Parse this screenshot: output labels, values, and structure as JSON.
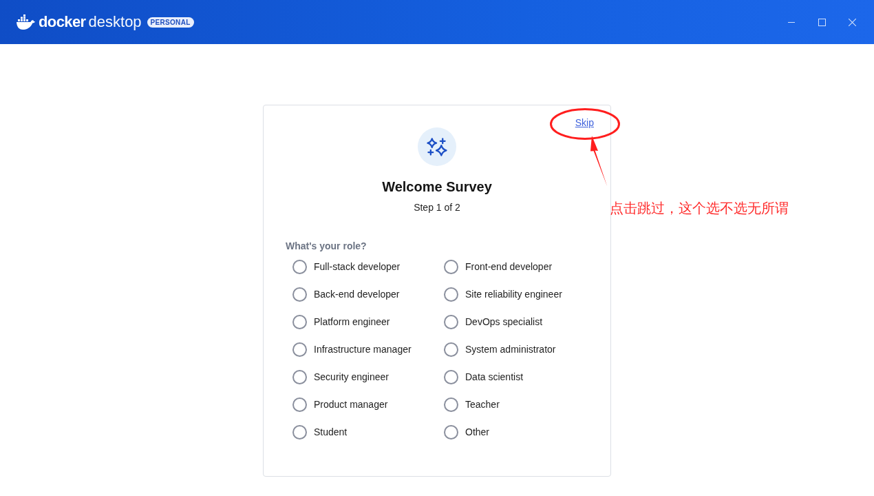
{
  "title_bar": {
    "logo_text": "docker",
    "product_text": "desktop",
    "plan_badge": "PERSONAL"
  },
  "survey": {
    "skip_link": "Skip",
    "title": "Welcome Survey",
    "step": "Step 1 of 2",
    "question": "What's your role?",
    "options": [
      {
        "label": "Full-stack developer",
        "selected": false
      },
      {
        "label": "Front-end developer",
        "selected": false
      },
      {
        "label": "Back-end developer",
        "selected": false
      },
      {
        "label": "Site reliability engineer",
        "selected": false
      },
      {
        "label": "Platform engineer",
        "selected": false
      },
      {
        "label": "DevOps specialist",
        "selected": false
      },
      {
        "label": "Infrastructure manager",
        "selected": false
      },
      {
        "label": "System administrator",
        "selected": false
      },
      {
        "label": "Security engineer",
        "selected": false
      },
      {
        "label": "Data scientist",
        "selected": false
      },
      {
        "label": "Product manager",
        "selected": false
      },
      {
        "label": "Teacher",
        "selected": false
      },
      {
        "label": "Student",
        "selected": false
      },
      {
        "label": "Other",
        "selected": false
      }
    ]
  },
  "annotation": {
    "note": "点击跳过，这个选不选无所谓"
  }
}
